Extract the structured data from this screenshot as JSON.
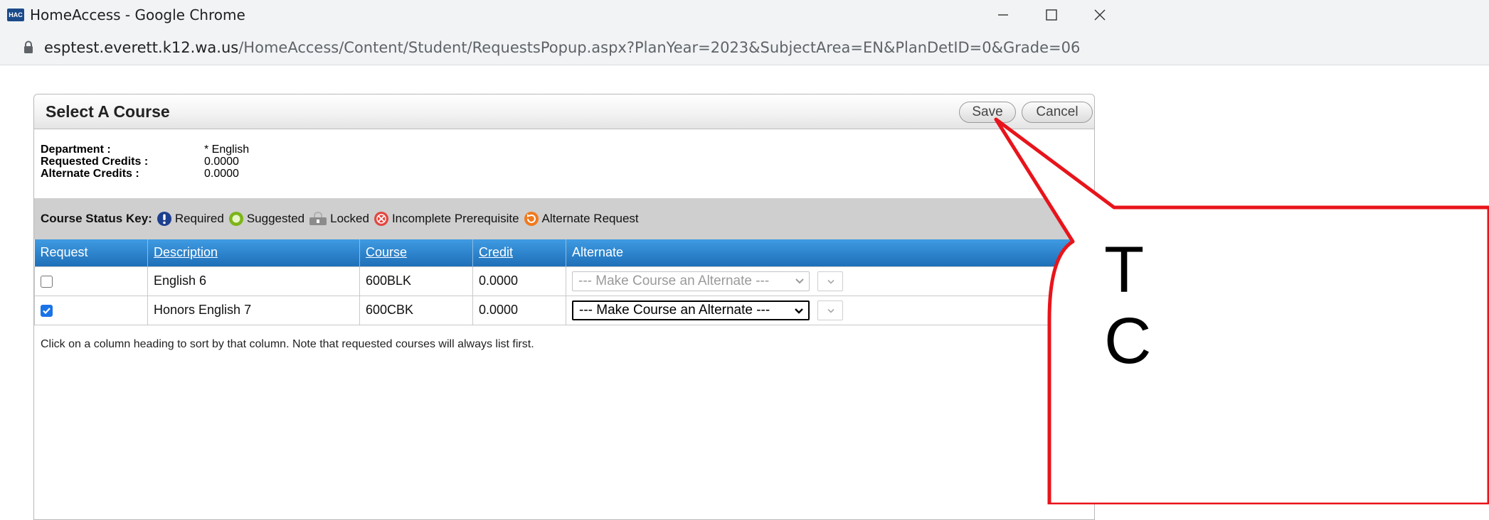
{
  "browser": {
    "logo_text": "HAC",
    "window_title": "HomeAccess - Google Chrome",
    "url_host": "esptest.everett.k12.wa.us",
    "url_path": "/HomeAccess/Content/Student/RequestsPopup.aspx?PlanYear=2023&SubjectArea=EN&PlanDetID=0&Grade=06"
  },
  "popup": {
    "title": "Select A Course",
    "save_label": "Save",
    "cancel_label": "Cancel"
  },
  "info": {
    "department_label": "Department :",
    "department_value": "* English",
    "requested_label": "Requested Credits :",
    "requested_value": "0.0000",
    "alternate_label": "Alternate Credits :",
    "alternate_value": "0.0000"
  },
  "status_key": {
    "label": "Course Status Key:",
    "required": "Required",
    "suggested": "Suggested",
    "locked": "Locked",
    "incomplete": "Incomplete Prerequisite",
    "alternate": "Alternate Request"
  },
  "table": {
    "headers": {
      "request": "Request",
      "description": "Description",
      "course": "Course",
      "credit": "Credit",
      "alternate": "Alternate"
    },
    "rows": [
      {
        "checked": false,
        "description": "English 6",
        "course": "600BLK",
        "credit": "0.0000",
        "alternate": "--- Make Course an Alternate ---",
        "alternate_enabled": false
      },
      {
        "checked": true,
        "description": "Honors English 7",
        "course": "600CBK",
        "credit": "0.0000",
        "alternate": "--- Make Course an Alternate ---",
        "alternate_enabled": true
      }
    ]
  },
  "note": "Click on a column heading to sort by that column. Note that requested courses will always list first.",
  "callout": {
    "text_line1": "T",
    "text_line2": "C"
  },
  "colors": {
    "header_blue": "#1e6fb8",
    "callout_red": "#e8141b",
    "checkbox_blue": "#1a73e8"
  }
}
